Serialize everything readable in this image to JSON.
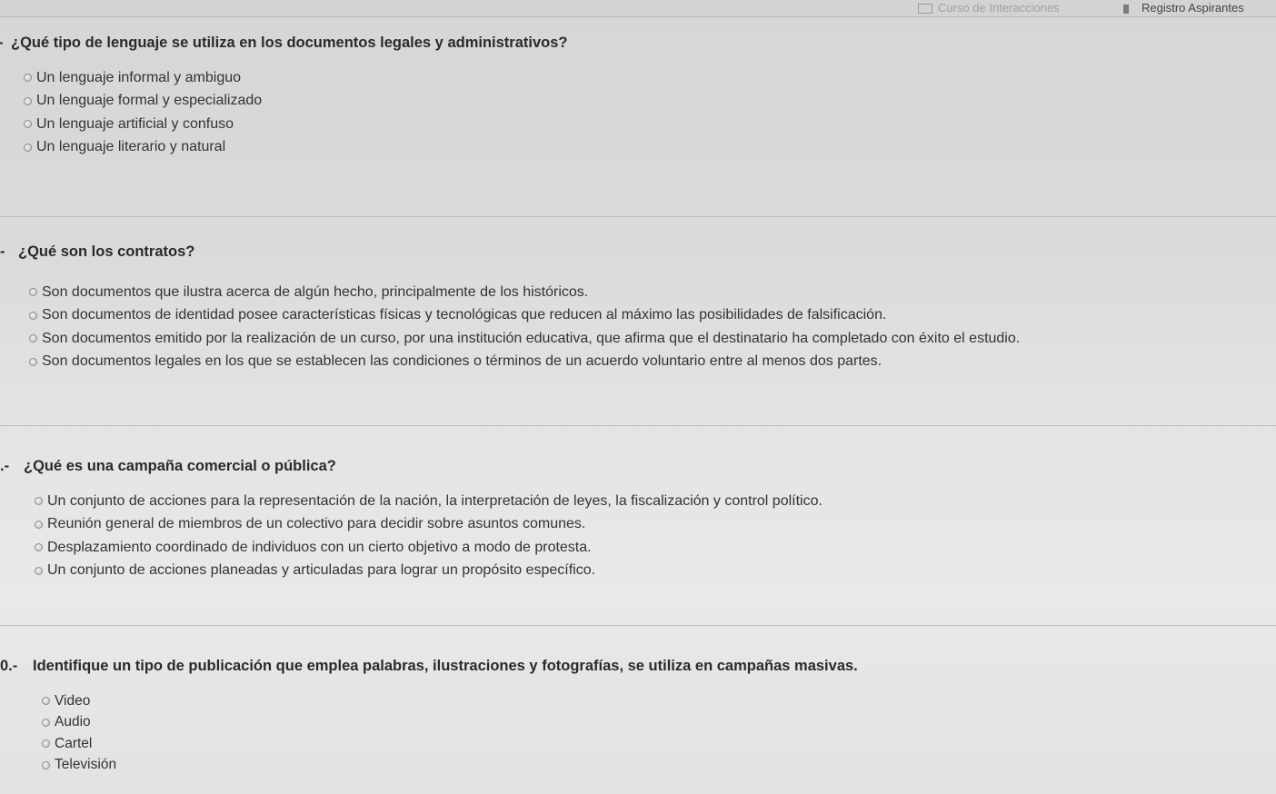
{
  "browser": {
    "tabs": [
      {
        "label": "Curso de Interacciones"
      },
      {
        "label": "Registro Aspirantes"
      }
    ]
  },
  "questions": [
    {
      "number": "-",
      "title": "¿Qué tipo de lenguaje se utiliza en los documentos legales y administrativos?",
      "options": [
        "Un lenguaje informal y ambiguo",
        "Un lenguaje formal y especializado",
        "Un lenguaje artificial y confuso",
        "Un lenguaje literario y natural"
      ]
    },
    {
      "number": "-",
      "title": "¿Qué son los contratos?",
      "options": [
        "Son documentos que ilustra acerca de algún hecho, principalmente de los históricos.",
        "Son documentos de identidad posee características físicas y tecnológicas que reducen al máximo las posibilidades de falsificación.",
        "Son documentos emitido por la realización de un curso, por una institución educativa, que afirma que el destinatario ha completado con éxito el estudio.",
        "Son documentos legales en los que se establecen las condiciones o términos de un acuerdo voluntario entre al menos dos partes."
      ]
    },
    {
      "number": ".-",
      "title": "¿Qué es una campaña comercial o pública?",
      "options": [
        "Un conjunto de acciones para la representación de la nación, la interpretación de leyes, la fiscalización y control político.",
        "Reunión general de miembros de un colectivo para decidir sobre asuntos comunes.",
        "Desplazamiento coordinado de individuos con un cierto objetivo a modo de protesta.",
        "Un conjunto de acciones planeadas y articuladas para lograr un propósito específico."
      ]
    },
    {
      "number": "0.-",
      "title": "Identifique un tipo de publicación que emplea palabras, ilustraciones y fotografías, se utiliza en campañas masivas.",
      "options": [
        "Video",
        "Audio",
        "Cartel",
        "Televisión"
      ]
    }
  ]
}
